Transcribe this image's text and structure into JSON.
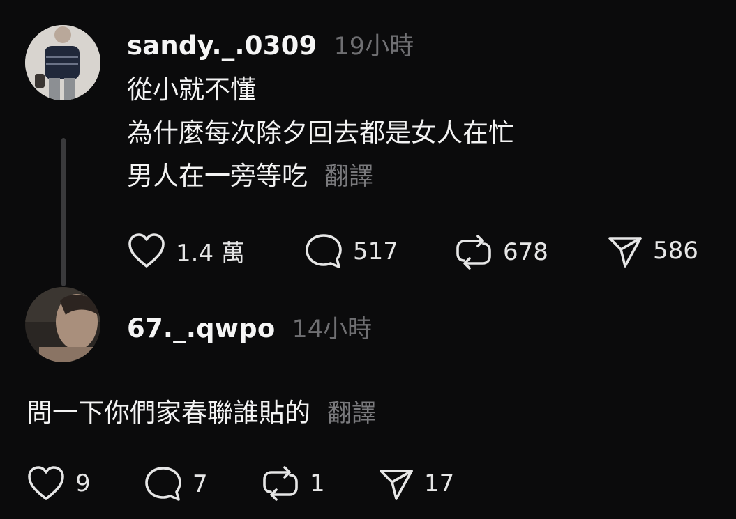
{
  "post1": {
    "username": "sandy._.0309",
    "time": "19小時",
    "lines": [
      "從小就不懂",
      "為什麼每次除夕回去都是女人在忙",
      "男人在一旁等吃"
    ],
    "translate": "翻譯",
    "likes": "1.4 萬",
    "comments": "517",
    "reposts": "678",
    "shares": "586"
  },
  "post2": {
    "username": "67._.qwpo",
    "time": "14小時",
    "text": "問一下你們家春聯誰貼的",
    "translate": "翻譯",
    "likes": "9",
    "comments": "7",
    "reposts": "1",
    "shares": "17"
  }
}
